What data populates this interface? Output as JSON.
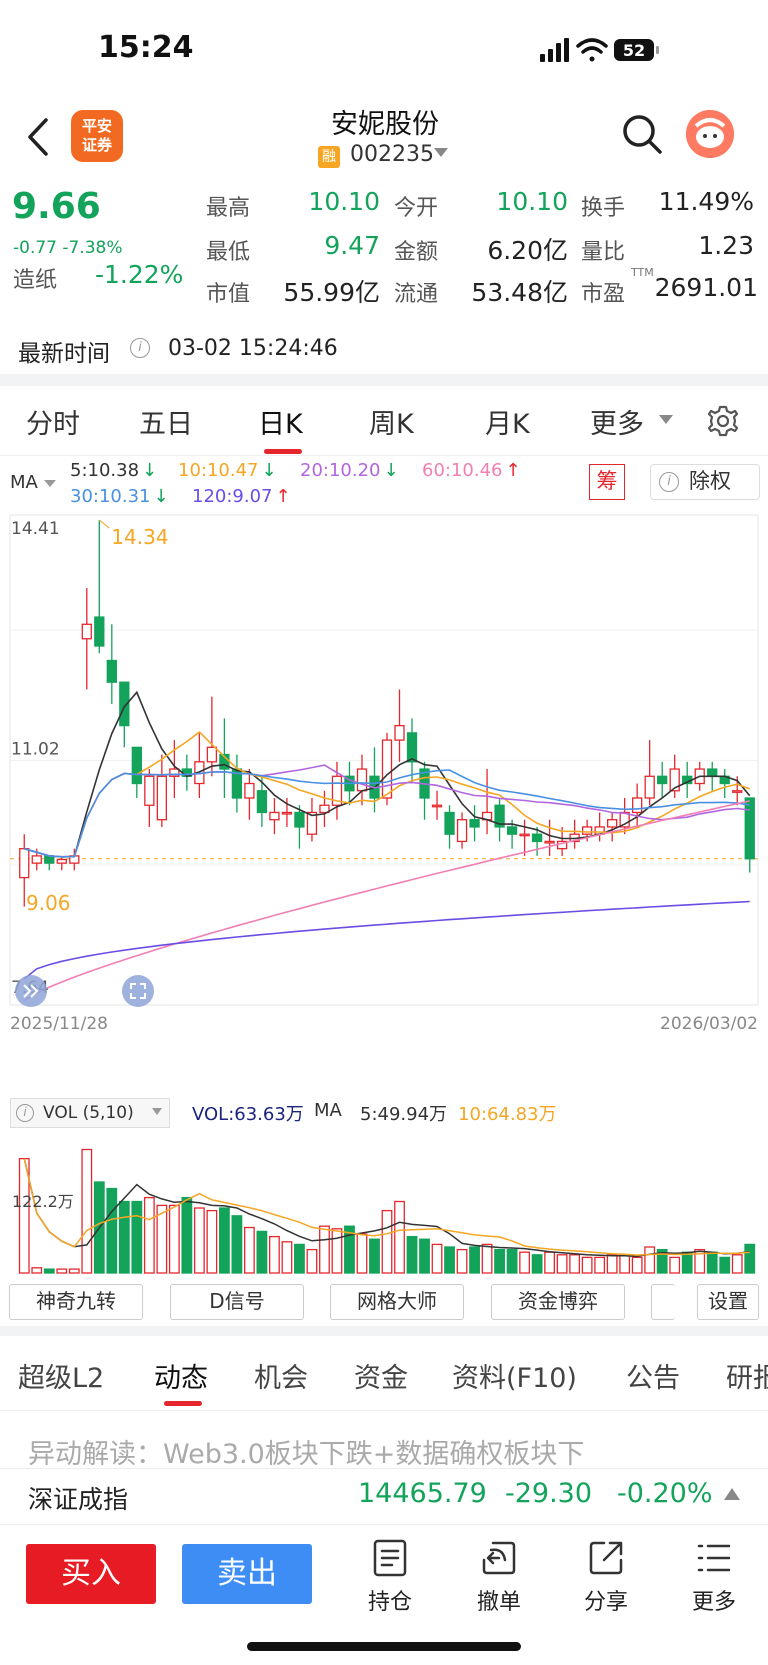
{
  "status_bar": {
    "time": "15:24",
    "battery": "52"
  },
  "header": {
    "logo_text": "平安\n证券",
    "stock_name": "安妮股份",
    "badge": "融",
    "code": "002235"
  },
  "quote": {
    "price": "9.66",
    "change": "-0.77  -7.38%",
    "sector_label": "造纸",
    "sector_change": "-1.22%",
    "rows": [
      [
        {
          "label": "最高",
          "value": "10.10"
        },
        {
          "label": "今开",
          "value": "10.10"
        },
        {
          "label": "换手",
          "value": "11.49%"
        }
      ],
      [
        {
          "label": "最低",
          "value": "9.47"
        },
        {
          "label": "金额",
          "value": "6.20亿"
        },
        {
          "label": "量比",
          "value": "1.23"
        }
      ],
      [
        {
          "label": "市值",
          "value": "55.99亿"
        },
        {
          "label": "流通",
          "value": "53.48亿"
        },
        {
          "label": "市盈",
          "value": "2691.01"
        }
      ]
    ],
    "pe_sup": "TTM",
    "update_label": "最新时间",
    "update_time": "03-02 15:24:46"
  },
  "period_tabs": [
    "分时",
    "五日",
    "日K",
    "周K",
    "月K",
    "更多"
  ],
  "ma_legend": {
    "title": "MA",
    "items": [
      {
        "text": "5:10.38",
        "color": "#333333",
        "arrow": "down"
      },
      {
        "text": "10:10.47",
        "color": "#f5a623",
        "arrow": "down"
      },
      {
        "text": "20:10.20",
        "color": "#b266e0",
        "arrow": "down"
      },
      {
        "text": "60:10.46",
        "color": "#f07fb4",
        "arrow": "up"
      },
      {
        "text": "30:10.31",
        "color": "#4a90e2",
        "arrow": "down"
      },
      {
        "text": "120:9.07",
        "color": "#6b4de6",
        "arrow": "up"
      }
    ],
    "chou": "筹",
    "fuquan": "除权"
  },
  "kline": {
    "y_top": "14.41",
    "y_mid": "11.02",
    "y_bottom": "7.64",
    "date_start": "2025/11/28",
    "date_end": "2026/03/02",
    "high_mark": "14.34",
    "low_mark": "9.06"
  },
  "chart_data": {
    "type": "candlestick",
    "ylim": [
      7.64,
      14.41
    ],
    "candles": [
      [
        9.4,
        9.8,
        9.0,
        10.0
      ],
      [
        9.6,
        9.7,
        9.5,
        9.8
      ],
      [
        9.7,
        9.6,
        9.5,
        9.7
      ],
      [
        9.6,
        9.65,
        9.5,
        9.7
      ],
      [
        9.6,
        9.7,
        9.5,
        9.8
      ],
      [
        12.7,
        12.9,
        12.0,
        13.4
      ],
      [
        13.0,
        12.6,
        12.5,
        14.34
      ],
      [
        12.4,
        12.1,
        11.8,
        12.9
      ],
      [
        12.1,
        11.5,
        11.2,
        12.1
      ],
      [
        11.2,
        10.7,
        10.5,
        11.2
      ],
      [
        10.4,
        10.8,
        10.1,
        10.9
      ],
      [
        10.2,
        10.8,
        10.1,
        11.1
      ],
      [
        10.8,
        10.9,
        10.5,
        11.3
      ],
      [
        10.9,
        10.8,
        10.6,
        11.1
      ],
      [
        10.7,
        11.0,
        10.5,
        11.4
      ],
      [
        11.0,
        11.2,
        10.8,
        11.9
      ],
      [
        11.1,
        10.9,
        10.5,
        11.6
      ],
      [
        10.9,
        10.5,
        10.3,
        11.1
      ],
      [
        10.5,
        10.7,
        10.2,
        10.9
      ],
      [
        10.6,
        10.3,
        10.1,
        10.8
      ],
      [
        10.2,
        10.3,
        10.0,
        10.5
      ],
      [
        10.3,
        10.3,
        10.1,
        10.5
      ],
      [
        10.3,
        10.1,
        9.8,
        10.4
      ],
      [
        10.0,
        10.3,
        9.9,
        10.5
      ],
      [
        10.3,
        10.4,
        10.1,
        10.6
      ],
      [
        10.4,
        10.8,
        10.2,
        11.0
      ],
      [
        10.8,
        10.6,
        10.4,
        11.0
      ],
      [
        10.6,
        10.9,
        10.4,
        11.1
      ],
      [
        10.8,
        10.5,
        10.3,
        11.2
      ],
      [
        10.5,
        11.3,
        10.4,
        11.4
      ],
      [
        11.3,
        11.5,
        11.0,
        12.0
      ],
      [
        11.4,
        11.0,
        10.7,
        11.6
      ],
      [
        10.9,
        10.5,
        10.2,
        11.0
      ],
      [
        10.4,
        10.4,
        10.2,
        10.6
      ],
      [
        10.3,
        10.0,
        9.8,
        10.4
      ],
      [
        9.9,
        10.2,
        9.8,
        10.3
      ],
      [
        10.2,
        10.1,
        9.9,
        10.4
      ],
      [
        10.2,
        10.3,
        10.0,
        10.9
      ],
      [
        10.4,
        10.1,
        9.9,
        10.5
      ],
      [
        10.1,
        10.0,
        9.8,
        10.2
      ],
      [
        10.0,
        10.0,
        9.7,
        10.2
      ],
      [
        10.0,
        9.9,
        9.7,
        10.1
      ],
      [
        9.9,
        9.9,
        9.7,
        10.2
      ],
      [
        9.8,
        9.9,
        9.7,
        10.1
      ],
      [
        9.9,
        10.0,
        9.8,
        10.2
      ],
      [
        10.0,
        10.1,
        9.9,
        10.2
      ],
      [
        10.0,
        10.1,
        9.9,
        10.3
      ],
      [
        10.1,
        10.2,
        9.9,
        10.3
      ],
      [
        10.1,
        10.3,
        10.0,
        10.5
      ],
      [
        10.3,
        10.5,
        10.1,
        10.7
      ],
      [
        10.5,
        10.8,
        10.4,
        11.3
      ],
      [
        10.8,
        10.7,
        10.5,
        11.0
      ],
      [
        10.6,
        10.9,
        10.5,
        11.1
      ],
      [
        10.8,
        10.7,
        10.5,
        11.0
      ],
      [
        10.7,
        10.9,
        10.6,
        11.0
      ],
      [
        10.9,
        10.8,
        10.6,
        11.0
      ],
      [
        10.8,
        10.7,
        10.5,
        10.9
      ],
      [
        10.6,
        10.6,
        10.4,
        10.8
      ],
      [
        10.5,
        9.66,
        9.47,
        10.1
      ]
    ],
    "x_start": "2025/11/28",
    "x_end": "2026/03/02"
  },
  "volume": {
    "legend": "VOL (5,10)",
    "vol": "VOL:63.63万",
    "ma_label": "MA",
    "ma5": "5:49.94万",
    "ma10": "10:64.83万",
    "y_label": "122.2万",
    "bars": [
      88,
      4,
      3,
      3,
      3,
      95,
      70,
      65,
      55,
      55,
      58,
      52,
      52,
      58,
      50,
      48,
      50,
      44,
      35,
      32,
      28,
      24,
      22,
      18,
      36,
      34,
      36,
      30,
      26,
      48,
      55,
      28,
      26,
      22,
      20,
      18,
      20,
      22,
      18,
      18,
      16,
      14,
      16,
      14,
      14,
      12,
      12,
      14,
      14,
      12,
      20,
      18,
      12,
      16,
      18,
      16,
      12,
      14,
      22
    ]
  },
  "indicator_buttons": [
    "神奇九转",
    "D信号",
    "网格大师",
    "资金博弈",
    "",
    "设置"
  ],
  "bottom_tabs": [
    "超级L2",
    "动态",
    "机会",
    "资金",
    "资料(F10)",
    "公告",
    "研报"
  ],
  "news": "异动解读：Web3.0板块下跌+数据确权板块下",
  "index_bar": {
    "name": "深证成指",
    "value": "14465.79",
    "change": "-29.30",
    "pct": "-0.20%"
  },
  "actions": {
    "buy": "买入",
    "sell": "卖出",
    "items": [
      "持仓",
      "撤单",
      "分享",
      "更多"
    ]
  }
}
